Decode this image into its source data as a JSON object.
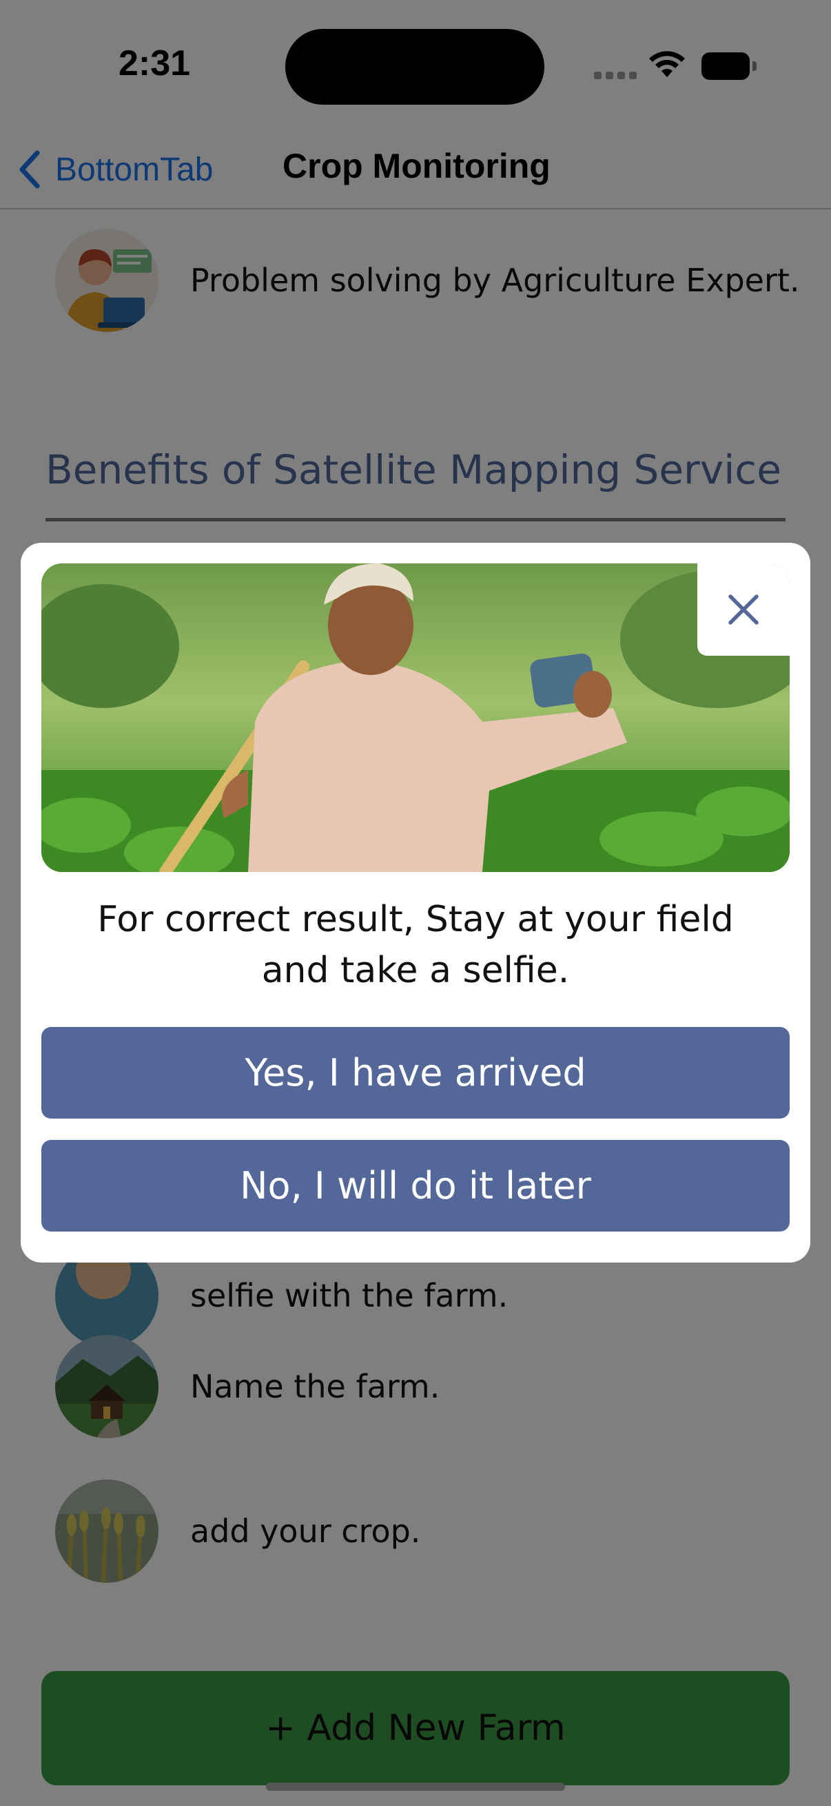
{
  "status_bar": {
    "time": "2:31"
  },
  "nav": {
    "back_label": "BottomTab",
    "title": "Crop Monitoring"
  },
  "steps": [
    {
      "text": "Problem solving by Agriculture Expert."
    },
    {
      "text": "selfie with the farm."
    },
    {
      "text": "Name the farm."
    },
    {
      "text": "add your crop."
    }
  ],
  "section": {
    "title": "Benefits of Satellite Mapping Service"
  },
  "add_farm": {
    "label": "+ Add New Farm"
  },
  "modal": {
    "message_line1": "For correct result, Stay at your field",
    "message_line2": "and take a selfie.",
    "confirm_label": "Yes, I have arrived",
    "later_label": "No, I will do it later"
  },
  "colors": {
    "accent_blue": "#536899",
    "link_blue": "#1a73e8",
    "add_farm_green": "#3a9a43",
    "section_title": "#51669a"
  },
  "icons": {
    "back": "chevron-left-icon",
    "close": "close-icon",
    "wifi": "wifi-icon",
    "battery": "battery-icon"
  }
}
